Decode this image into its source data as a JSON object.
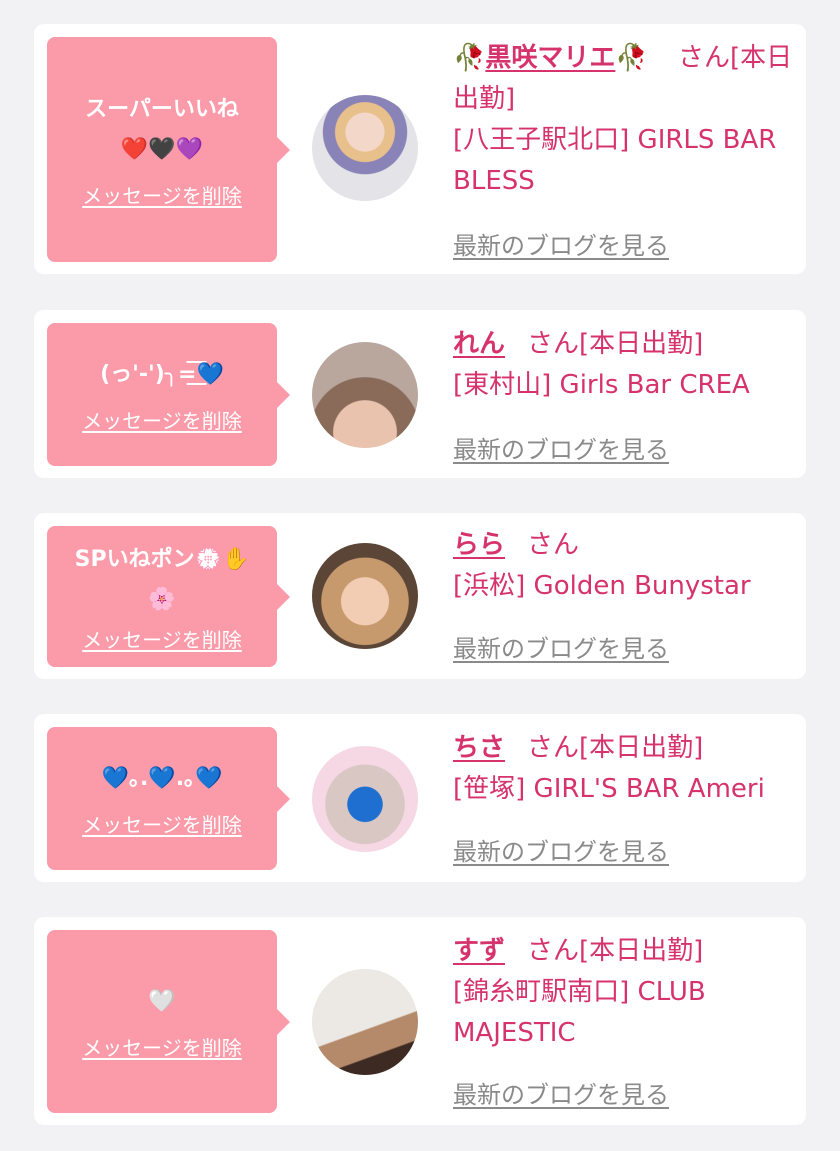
{
  "delete_label": "メッセージを削除",
  "blog_label": "最新のブログを見る",
  "colors": {
    "bubble": "#fb9aa9",
    "name": "#d6336c",
    "link_gray": "#8a8a8a",
    "background": "#f2f2f4"
  },
  "entries": [
    {
      "message": "スーパーいいね",
      "message_emoji": "❤️🖤💜",
      "name": "黒咲マリエ",
      "name_decor_left": "🥀",
      "name_decor_right": "🥀",
      "suffix": "さん[本日出勤]",
      "shop": "[八王子駅北口] GIRLS BAR BLESS"
    },
    {
      "message": "(っ'-')╮=͟͟͞͞💙",
      "name": "れん",
      "suffix": "さん[本日出勤]",
      "shop": "[東村山] Girls Bar CREA"
    },
    {
      "message": "SPいねポン💮✋🌸",
      "name": "らら",
      "suffix": "さん",
      "shop": "[浜松] Golden Bunystar"
    },
    {
      "message": "💙｡.💙.｡💙",
      "name": "ちさ",
      "suffix": "さん[本日出勤]",
      "shop": "[笹塚] GIRL'S BAR Ameri"
    },
    {
      "message": "🤍",
      "name": "すず",
      "suffix": "さん[本日出勤]",
      "shop": "[錦糸町駅南口] CLUB MAJESTIC"
    }
  ]
}
